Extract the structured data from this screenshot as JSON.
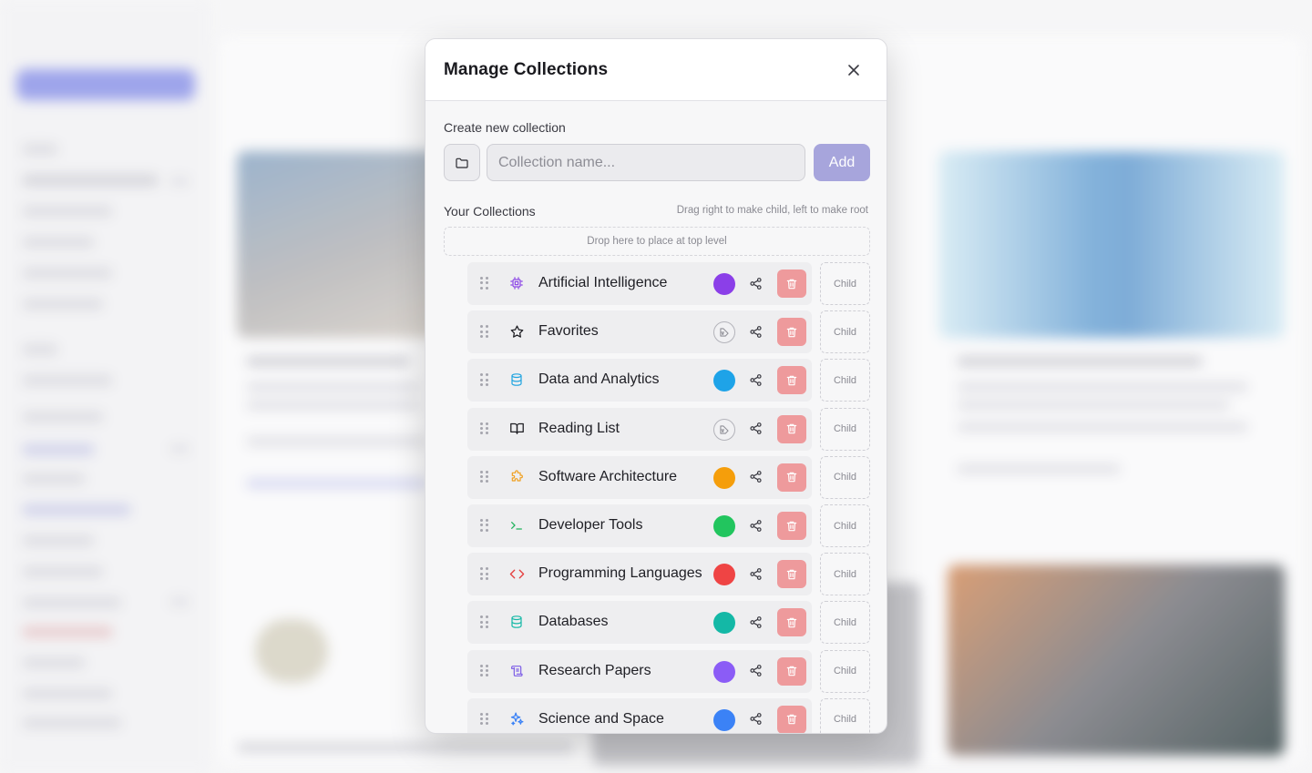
{
  "modal": {
    "title": "Manage Collections",
    "create_label": "Create new collection",
    "input_placeholder": "Collection name...",
    "input_value": "",
    "add_label": "Add",
    "your_collections_label": "Your Collections",
    "drag_hint": "Drag right to make child, left to make root",
    "drop_zone_label": "Drop here to place at top level",
    "child_label": "Child"
  },
  "collections": [
    {
      "name": "Artificial Intelligence",
      "icon": "cpu-icon",
      "icon_color": "#8b45e6",
      "color": "#8b3fe8"
    },
    {
      "name": "Favorites",
      "icon": "star-icon",
      "icon_color": "#1f1f24",
      "color": null
    },
    {
      "name": "Data and Analytics",
      "icon": "database-icon",
      "icon_color": "#20a4e0",
      "color": "#1ea3e8"
    },
    {
      "name": "Reading List",
      "icon": "book-open-icon",
      "icon_color": "#1f1f24",
      "color": null
    },
    {
      "name": "Software Architecture",
      "icon": "puzzle-icon",
      "icon_color": "#f0a020",
      "color": "#f59e0b"
    },
    {
      "name": "Developer Tools",
      "icon": "terminal-icon",
      "icon_color": "#22b35e",
      "color": "#22c55e"
    },
    {
      "name": "Programming Languages",
      "icon": "code-icon",
      "icon_color": "#e53e3e",
      "color": "#ef4444"
    },
    {
      "name": "Databases",
      "icon": "database-icon",
      "icon_color": "#14b8a6",
      "color": "#14b8a6"
    },
    {
      "name": "Research Papers",
      "icon": "scroll-icon",
      "icon_color": "#7c5ce6",
      "color": "#8b5cf6"
    },
    {
      "name": "Science and Space",
      "icon": "sparkles-icon",
      "icon_color": "#3b82f6",
      "color": "#3b82f6"
    }
  ]
}
